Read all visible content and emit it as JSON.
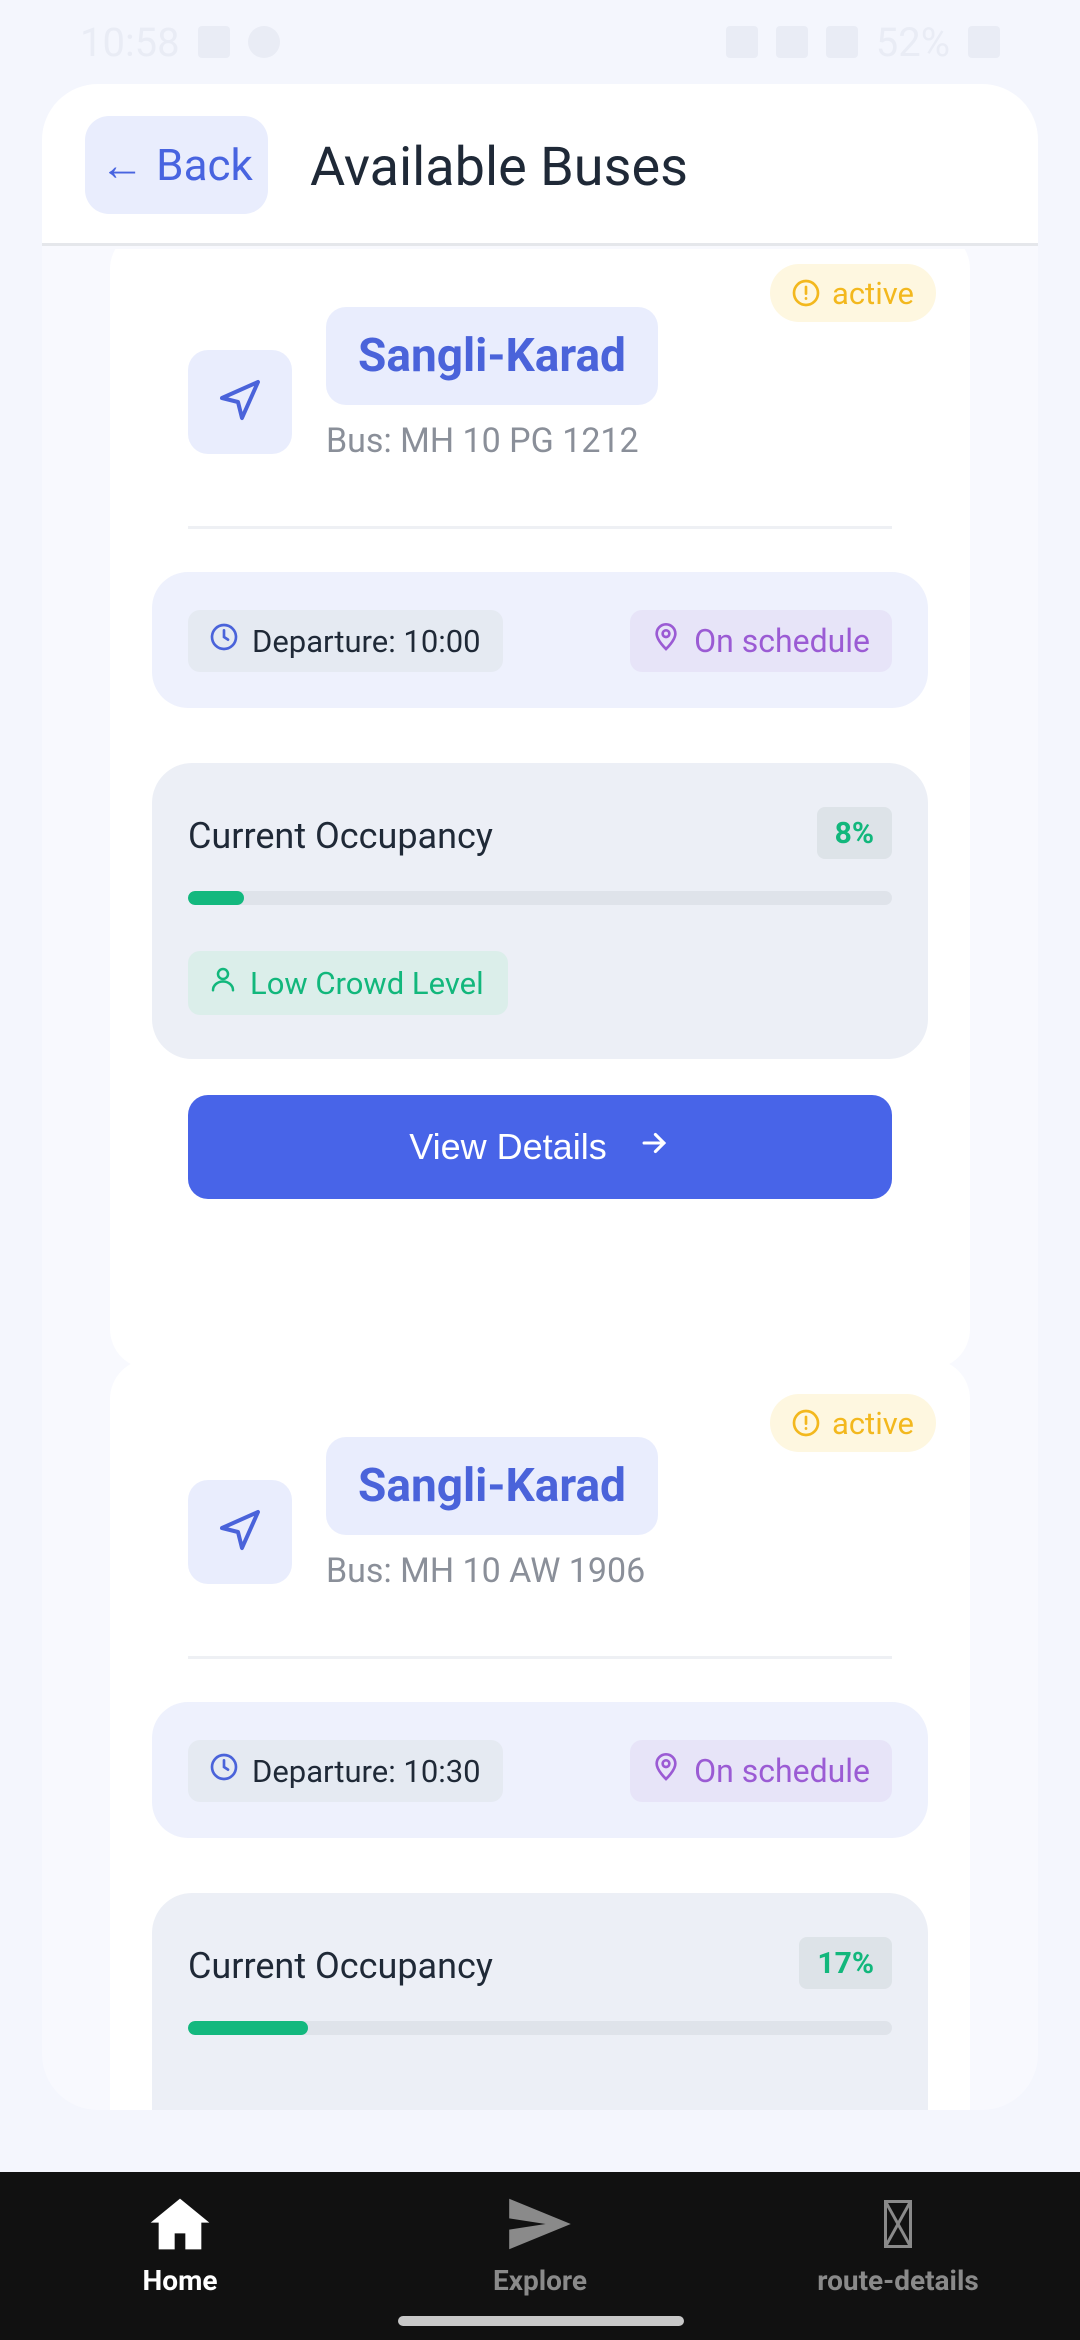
{
  "status_bar": {
    "time": "10:58",
    "battery": "52%"
  },
  "header": {
    "back_label": "Back",
    "title": "Available Buses"
  },
  "buses": [
    {
      "status": "active",
      "route": "Sangli-Karad",
      "bus_number": "Bus: MH 10 PG 1212",
      "departure": "Departure: 10:00",
      "schedule_status": "On schedule",
      "occupancy_label": "Current Occupancy",
      "occupancy_percent": "8%",
      "occupancy_fraction": 0.08,
      "crowd_level": "Low Crowd Level",
      "button_label": "View Details"
    },
    {
      "status": "active",
      "route": "Sangli-Karad",
      "bus_number": "Bus: MH 10 AW 1906",
      "departure": "Departure: 10:30",
      "schedule_status": "On schedule",
      "occupancy_label": "Current Occupancy",
      "occupancy_percent": "17%",
      "occupancy_fraction": 0.17
    }
  ],
  "bottom_nav": {
    "home": "Home",
    "explore": "Explore",
    "route_details": "route-details"
  },
  "colors": {
    "accent": "#4864e8",
    "active_badge": "#f3b81e",
    "on_schedule": "#9b5bd4",
    "occupancy_green": "#12b77c"
  }
}
